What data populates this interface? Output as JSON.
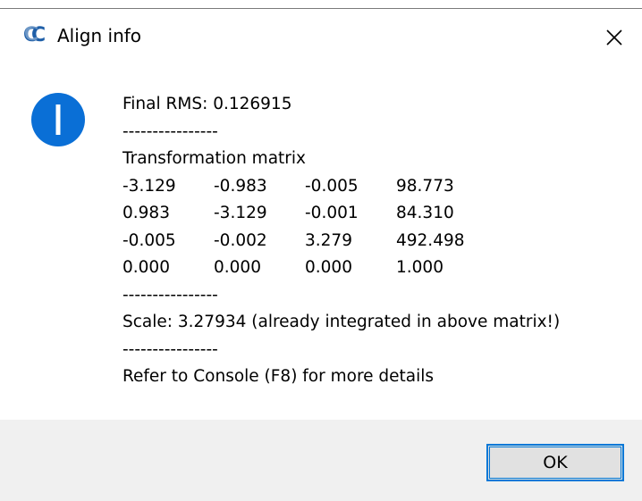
{
  "window": {
    "title": "Align info",
    "app_icon": "cloudcompare-icon",
    "close_icon": "close-icon"
  },
  "message": {
    "icon": "info-icon",
    "rms_line": "Final RMS: 0.126915",
    "separator": "----------------",
    "matrix_title": "Transformation matrix",
    "matrix": [
      [
        "-3.129",
        "-0.983",
        "-0.005",
        "98.773"
      ],
      [
        "0.983",
        "-3.129",
        "-0.001",
        "84.310"
      ],
      [
        "-0.005",
        "-0.002",
        "3.279",
        "492.498"
      ],
      [
        "0.000",
        "0.000",
        "0.000",
        "1.000"
      ]
    ],
    "scale_line": "Scale: 3.27934 (already integrated in above matrix!)",
    "console_line": "Refer to Console (F8) for more details"
  },
  "buttons": {
    "ok_label": "OK"
  },
  "colors": {
    "info_blue": "#0a6fd6",
    "button_border": "#0078d7",
    "footer_bg": "#f0f0f0"
  }
}
